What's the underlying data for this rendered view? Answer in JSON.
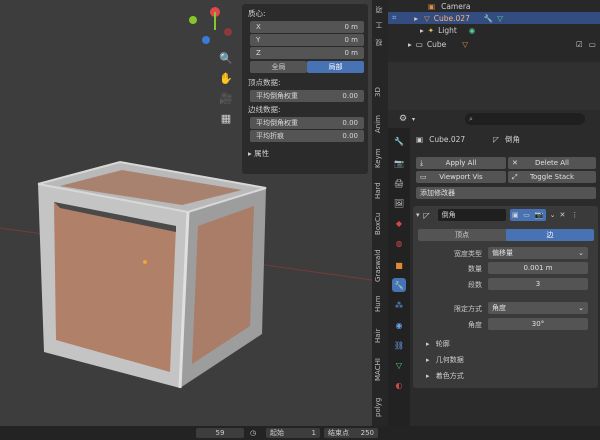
{
  "npanel": {
    "origin_label": "质心:",
    "x_label": "X",
    "x_value": "0 m",
    "y_label": "Y",
    "y_value": "0 m",
    "z_label": "Z",
    "z_value": "0 m",
    "global_label": "全局",
    "local_label": "局部",
    "vertex_data_label": "顶点数据:",
    "vertex_bevel_weight_label": "平均倒角权重",
    "vertex_bevel_weight_value": "0.00",
    "edge_data_label": "边线数据:",
    "edge_bevel_weight_label": "平均倒角权重",
    "edge_bevel_weight_value": "0.00",
    "edge_crease_label": "平均折痕",
    "edge_crease_value": "0.00",
    "attributes_label": "属性"
  },
  "side_tabs": [
    "项",
    "工",
    "视",
    "3D",
    "Anim",
    "Keym",
    "Hard",
    "BoxCu",
    "Graswald",
    "Hum",
    "Hair",
    "MACHI",
    "polyg"
  ],
  "outliner": {
    "rows": [
      {
        "label": "Camera",
        "selected": false
      },
      {
        "label": "Cube.027",
        "selected": true
      },
      {
        "label": "Light",
        "selected": false
      },
      {
        "label": "Cube",
        "selected": false
      }
    ]
  },
  "props": {
    "search_placeholder": "",
    "object_name": "Cube.027",
    "modifier_name": "倒角",
    "apply_all": "Apply All",
    "delete_all": "Delete All",
    "viewport_vis": "Viewport Vis",
    "toggle_stack": "Toggle Stack",
    "add_modifier": "添加修改器",
    "bevel_name": "倒角",
    "tab_vertex": "顶点",
    "tab_edge": "边",
    "width_type_label": "宽度类型",
    "width_type_value": "偏移量",
    "amount_label": "数量",
    "amount_value": "0.001 m",
    "segments_label": "段数",
    "segments_value": "3",
    "limit_method_label": "限定方式",
    "limit_method_value": "角度",
    "angle_label": "角度",
    "angle_value": "30°",
    "profile_label": "轮廓",
    "geometry_label": "几何数据",
    "shading_label": "着色方式"
  },
  "statusbar": {
    "frame": "59",
    "start_label": "起始",
    "start_value": "1",
    "end_label": "结束点",
    "end_value": "250"
  },
  "colors": {
    "accent": "#4772b3",
    "selection": "#334d80",
    "face": "#b68672",
    "frame": "#bfbfbf",
    "axis_x": "#e0474b",
    "axis_y": "#86c52c",
    "axis_z": "#3a7bd5"
  }
}
